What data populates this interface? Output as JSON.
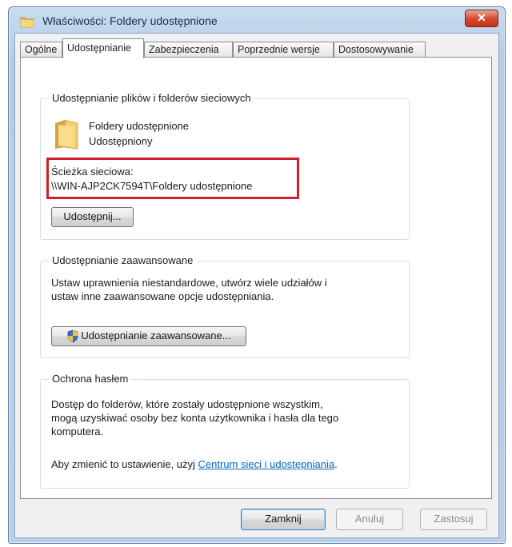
{
  "window": {
    "title": "Właściwości: Foldery udostępnione",
    "close_label": "✕"
  },
  "tabs": [
    {
      "label": "Ogólne",
      "active": false
    },
    {
      "label": "Udostępnianie",
      "active": true
    },
    {
      "label": "Zabezpieczenia",
      "active": false
    },
    {
      "label": "Poprzednie wersje",
      "active": false
    },
    {
      "label": "Dostosowywanie",
      "active": false
    }
  ],
  "network_sharing": {
    "group_title": "Udostępnianie plików i folderów sieciowych",
    "folder_name": "Foldery udostępnione",
    "status": "Udostępniony",
    "path_label": "Ścieżka sieciowa:",
    "path_value": "\\\\WIN-AJP2CK7594T\\Foldery udostępnione",
    "share_button": "Udostępnij..."
  },
  "advanced_sharing": {
    "group_title": "Udostępnianie zaawansowane",
    "description_line1": "Ustaw uprawnienia niestandardowe, utwórz wiele udziałów i",
    "description_line2": "ustaw inne zaawansowane opcje udostępniania.",
    "button": "Udostępnianie zaawansowane..."
  },
  "password_protection": {
    "group_title": "Ochrona hasłem",
    "description_line1": "Dostęp do folderów, które zostały udostępnione wszystkim,",
    "description_line2": "mogą uzyskiwać osoby bez konta użytkownika i hasła dla tego",
    "description_line3": "komputera.",
    "change_prefix": "Aby zmienić to ustawienie, użyj ",
    "change_link": "Centrum sieci i udostępniania",
    "change_suffix": "."
  },
  "footer": {
    "close_button": "Zamknij",
    "cancel_button": "Anuluj",
    "apply_button": "Zastosuj"
  },
  "colors": {
    "highlight_box": "#d11f2c",
    "link": "#0066cc",
    "close_button": "#d6472b"
  }
}
